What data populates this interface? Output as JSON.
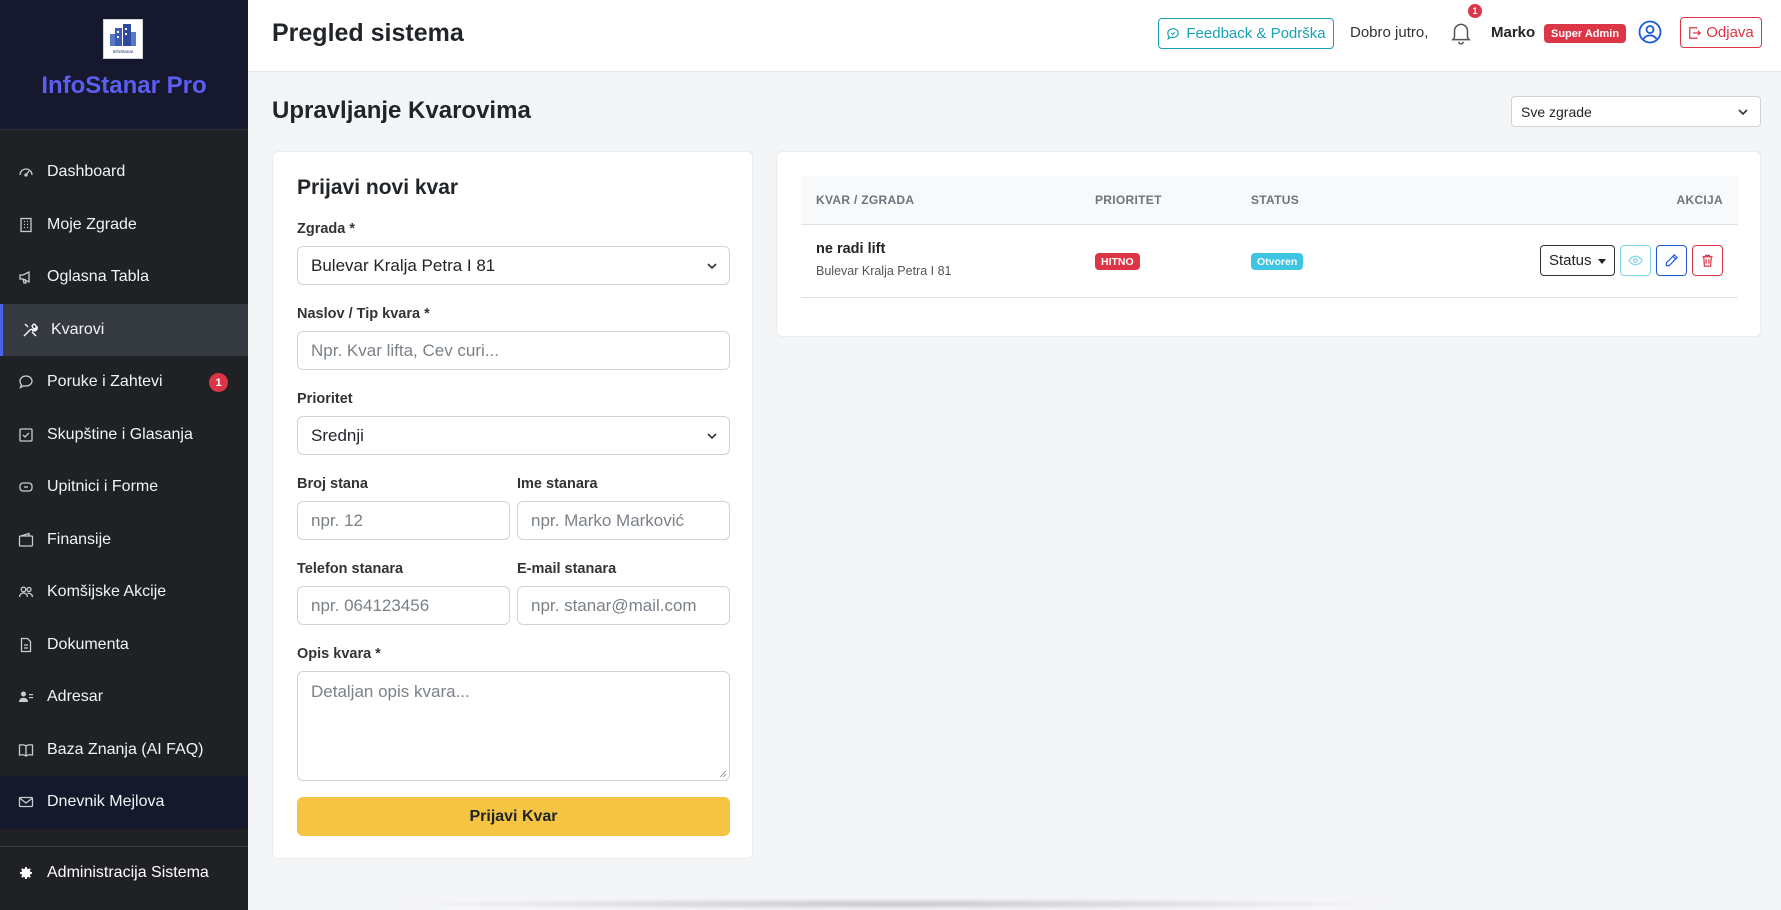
{
  "brand": {
    "name": "InfoStanar Pro",
    "logo_text": "InfoStanar"
  },
  "sidebar": {
    "items": [
      {
        "label": "Dashboard",
        "icon": "gauge-icon"
      },
      {
        "label": "Moje Zgrade",
        "icon": "building-icon"
      },
      {
        "label": "Oglasna Tabla",
        "icon": "megaphone-icon"
      },
      {
        "label": "Kvarovi",
        "icon": "tools-icon",
        "active": true
      },
      {
        "label": "Poruke i Zahtevi",
        "icon": "chat-icon",
        "badge": "1"
      },
      {
        "label": "Skupštine i Glasanja",
        "icon": "check-square-icon"
      },
      {
        "label": "Upitnici i Forme",
        "icon": "clipboard-icon"
      },
      {
        "label": "Finansije",
        "icon": "wallet-icon"
      },
      {
        "label": "Komšijske Akcije",
        "icon": "people-icon"
      },
      {
        "label": "Dokumenta",
        "icon": "document-icon"
      },
      {
        "label": "Adresar",
        "icon": "contacts-icon"
      },
      {
        "label": "Baza Znanja (AI FAQ)",
        "icon": "book-icon"
      },
      {
        "label": "Dnevnik Mejlova",
        "icon": "envelope-icon"
      }
    ],
    "admin_label": "Administracija Sistema"
  },
  "header": {
    "title": "Pregled sistema",
    "feedback_label": "Feedback & Podrška",
    "greeting": "Dobro jutro,",
    "notifications": "1",
    "user_name": "Marko",
    "role": "Super Admin",
    "logout_label": "Odjava"
  },
  "main": {
    "title": "Upravljanje Kvarovima",
    "building_filter": "Sve zgrade"
  },
  "form": {
    "title": "Prijavi novi kvar",
    "building_label": "Zgrada *",
    "building_value": "Bulevar Kralja Petra I 81",
    "title_label": "Naslov / Tip kvara *",
    "title_placeholder": "Npr. Kvar lifta, Cev curi...",
    "priority_label": "Prioritet",
    "priority_value": "Srednji",
    "apartment_label": "Broj stana",
    "apartment_placeholder": "npr. 12",
    "tenant_label": "Ime stanara",
    "tenant_placeholder": "npr. Marko Marković",
    "phone_label": "Telefon stanara",
    "phone_placeholder": "npr. 064123456",
    "email_label": "E-mail stanara",
    "email_placeholder": "npr. stanar@mail.com",
    "desc_label": "Opis kvara *",
    "desc_placeholder": "Detaljan opis kvara...",
    "submit_label": "Prijavi Kvar"
  },
  "table": {
    "columns": [
      "KVAR / ZGRADA",
      "PRIORITET",
      "STATUS",
      "AKCIJA"
    ],
    "rows": [
      {
        "title": "ne radi lift",
        "building": "Bulevar Kralja Petra I 81",
        "priority": "HITNO",
        "status": "Otvoren",
        "status_button": "Status"
      }
    ]
  },
  "colors": {
    "sidebar_bg": "#1f2124",
    "brand_accent": "#5b5ef0",
    "primary": "#1d5bd6",
    "danger": "#dc3545",
    "info": "#17a2b8",
    "warning": "#f4c442"
  }
}
